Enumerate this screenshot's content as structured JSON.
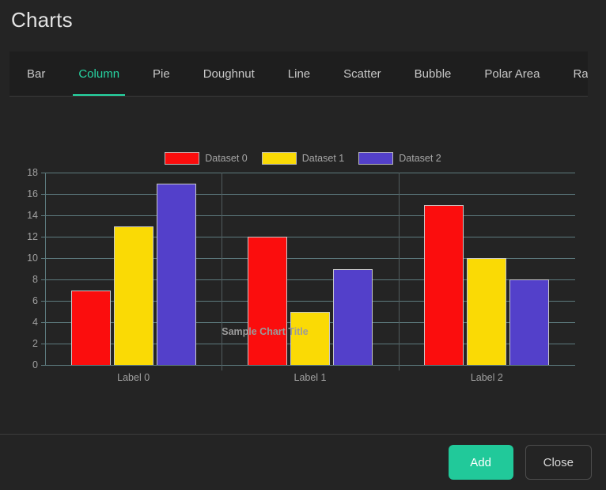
{
  "header": {
    "title": "Charts"
  },
  "tabs": [
    {
      "label": "Bar",
      "active": false
    },
    {
      "label": "Column",
      "active": true
    },
    {
      "label": "Pie",
      "active": false
    },
    {
      "label": "Doughnut",
      "active": false
    },
    {
      "label": "Line",
      "active": false
    },
    {
      "label": "Scatter",
      "active": false
    },
    {
      "label": "Bubble",
      "active": false
    },
    {
      "label": "Polar Area",
      "active": false
    },
    {
      "label": "Radar",
      "active": false
    }
  ],
  "footer": {
    "add_label": "Add",
    "close_label": "Close"
  },
  "colors": {
    "accent": "#21c99a",
    "background": "#242424",
    "tabbar": "#1e1e1e",
    "gridline": "#5d7a7e",
    "dataset0": "#fb0d0d",
    "dataset1": "#fada05",
    "dataset2": "#5340ca"
  },
  "chart_data": {
    "type": "bar",
    "title": "Sample Chart Title",
    "xlabel": "",
    "ylabel": "",
    "categories": [
      "Label 0",
      "Label 1",
      "Label 2"
    ],
    "series": [
      {
        "name": "Dataset 0",
        "color": "#fb0d0d",
        "values": [
          7,
          12,
          15
        ]
      },
      {
        "name": "Dataset 1",
        "color": "#fada05",
        "values": [
          13,
          5,
          10
        ]
      },
      {
        "name": "Dataset 2",
        "color": "#5340ca",
        "values": [
          17,
          9,
          8
        ]
      }
    ],
    "ylim": [
      0,
      18
    ],
    "yticks": [
      0,
      2,
      4,
      6,
      8,
      10,
      12,
      14,
      16,
      18
    ],
    "grid": true,
    "legend_position": "top"
  }
}
